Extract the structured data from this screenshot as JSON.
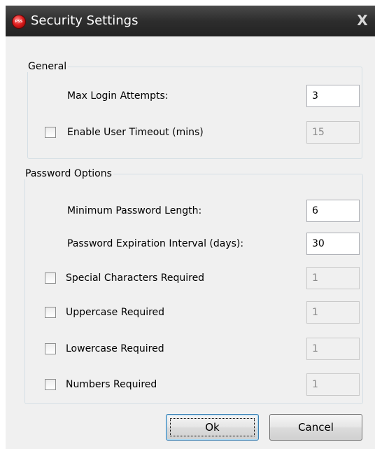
{
  "window": {
    "title": "Security Settings",
    "close_glyph": "X",
    "app_icon": "app-logo-icon",
    "app_icon_text": "PSS"
  },
  "general": {
    "legend": "General",
    "max_login_attempts": {
      "label": "Max Login Attempts:",
      "value": "3"
    },
    "user_timeout": {
      "label": "Enable User Timeout (mins)",
      "checked": false,
      "value": "15",
      "enabled": false
    }
  },
  "password_options": {
    "legend": "Password Options",
    "min_length": {
      "label": "Minimum Password Length:",
      "value": "6"
    },
    "expiration": {
      "label": "Password Expiration Interval (days):",
      "value": "30"
    },
    "special_chars": {
      "label": "Special Characters Required",
      "checked": false,
      "value": "1",
      "enabled": false
    },
    "uppercase": {
      "label": "Uppercase Required",
      "checked": false,
      "value": "1",
      "enabled": false
    },
    "lowercase": {
      "label": "Lowercase Required",
      "checked": false,
      "value": "1",
      "enabled": false
    },
    "numbers": {
      "label": "Numbers Required",
      "checked": false,
      "value": "1",
      "enabled": false
    }
  },
  "buttons": {
    "ok": "Ok",
    "cancel": "Cancel"
  },
  "colors": {
    "titlebar": "#2d2d2d",
    "dialog_background": "#f0f0f0",
    "groupbox_border": "#d5dfe5",
    "default_button_border": "#3c7fb1"
  }
}
